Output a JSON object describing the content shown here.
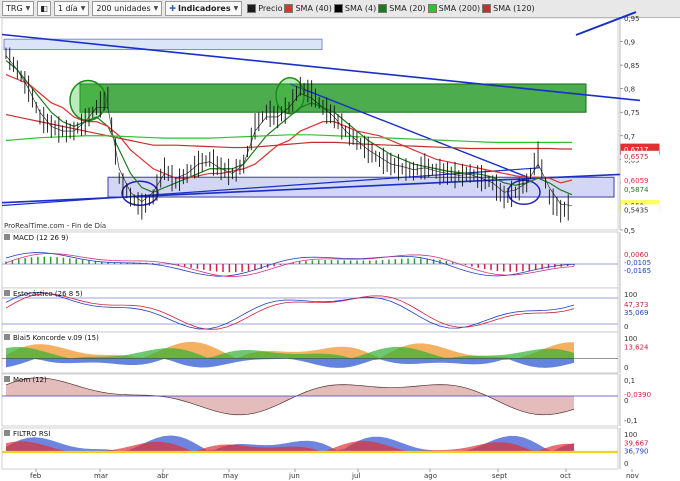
{
  "toolbar": {
    "symbol": "TRG",
    "timeframe": "1 día",
    "units": "200 unidades",
    "indicators_label": "Indicadores",
    "legend": [
      {
        "label": "Precio",
        "color": "#1a1a1a"
      },
      {
        "label": "SMA (40)",
        "color": "#e03030"
      },
      {
        "label": "SMA (4)",
        "color": "#000000"
      },
      {
        "label": "SMA (20)",
        "color": "#1f7a1f"
      },
      {
        "label": "SMA (200)",
        "color": "#30c030"
      },
      {
        "label": "SMA (120)",
        "color": "#c03030"
      }
    ]
  },
  "watermark": "ProRealTime.com - Fin de Día",
  "months": [
    "feb",
    "mar",
    "abr",
    "may",
    "jun",
    "jul",
    "ago",
    "sept",
    "oct",
    "nov"
  ],
  "chart_data": [
    {
      "type": "line",
      "name": "price",
      "ylim": [
        0.5,
        0.95
      ],
      "y_ticks": [
        "0,95",
        "0,9",
        "0,85",
        "0,8",
        "0,75",
        "0,7",
        "0,65",
        "0,6",
        "0,55",
        "0,5"
      ],
      "x_months": [
        "feb",
        "mar",
        "abr",
        "may",
        "jun",
        "jul",
        "ago",
        "sept",
        "oct",
        "nov"
      ],
      "price_series": [
        0.875,
        0.84,
        0.8,
        0.74,
        0.72,
        0.71,
        0.71,
        0.73,
        0.76,
        0.78,
        0.61,
        0.57,
        0.55,
        0.57,
        0.63,
        0.6,
        0.62,
        0.64,
        0.65,
        0.63,
        0.62,
        0.64,
        0.72,
        0.75,
        0.74,
        0.76,
        0.805,
        0.79,
        0.76,
        0.74,
        0.71,
        0.69,
        0.67,
        0.65,
        0.64,
        0.63,
        0.625,
        0.635,
        0.625,
        0.62,
        0.615,
        0.62,
        0.61,
        0.6,
        0.57,
        0.58,
        0.6,
        0.66,
        0.57,
        0.54,
        0.552
      ],
      "sma_series": [
        {
          "name": "SMA (4)",
          "color": "#1a1a1a",
          "values": [
            0.87,
            0.84,
            0.8,
            0.75,
            0.72,
            0.71,
            0.71,
            0.73,
            0.76,
            0.76,
            0.63,
            0.58,
            0.56,
            0.58,
            0.62,
            0.61,
            0.62,
            0.64,
            0.645,
            0.63,
            0.62,
            0.64,
            0.71,
            0.74,
            0.74,
            0.76,
            0.79,
            0.78,
            0.76,
            0.74,
            0.71,
            0.69,
            0.67,
            0.655,
            0.64,
            0.635,
            0.628,
            0.632,
            0.625,
            0.62,
            0.616,
            0.618,
            0.61,
            0.6,
            0.58,
            0.585,
            0.6,
            0.64,
            0.59,
            0.555,
            0.552
          ]
        },
        {
          "name": "SMA (20)",
          "color": "#1f7a1f",
          "values": [
            0.86,
            0.84,
            0.81,
            0.78,
            0.75,
            0.73,
            0.72,
            0.73,
            0.74,
            0.72,
            0.67,
            0.62,
            0.59,
            0.58,
            0.59,
            0.6,
            0.61,
            0.62,
            0.63,
            0.63,
            0.63,
            0.64,
            0.67,
            0.7,
            0.72,
            0.74,
            0.76,
            0.77,
            0.76,
            0.75,
            0.73,
            0.71,
            0.69,
            0.675,
            0.66,
            0.65,
            0.64,
            0.635,
            0.63,
            0.625,
            0.622,
            0.62,
            0.618,
            0.612,
            0.6,
            0.595,
            0.6,
            0.61,
            0.6,
            0.585,
            0.575
          ]
        },
        {
          "name": "SMA (40)",
          "color": "#e03030",
          "values": [
            0.83,
            0.82,
            0.81,
            0.79,
            0.77,
            0.76,
            0.74,
            0.73,
            0.73,
            0.72,
            0.7,
            0.67,
            0.65,
            0.63,
            0.62,
            0.61,
            0.61,
            0.615,
            0.62,
            0.62,
            0.625,
            0.63,
            0.64,
            0.66,
            0.68,
            0.69,
            0.71,
            0.72,
            0.73,
            0.73,
            0.72,
            0.71,
            0.705,
            0.7,
            0.69,
            0.68,
            0.67,
            0.66,
            0.65,
            0.645,
            0.64,
            0.635,
            0.63,
            0.625,
            0.62,
            0.615,
            0.612,
            0.612,
            0.61,
            0.6,
            0.606
          ]
        },
        {
          "name": "SMA (120)",
          "color": "#c03030",
          "values": [
            0.745,
            0.74,
            0.735,
            0.73,
            0.725,
            0.72,
            0.715,
            0.71,
            0.705,
            0.7,
            0.695,
            0.69,
            0.685,
            0.68,
            0.68,
            0.68,
            0.679,
            0.678,
            0.677,
            0.676,
            0.675,
            0.675,
            0.676,
            0.678,
            0.68,
            0.682,
            0.684,
            0.686,
            0.686,
            0.686,
            0.685,
            0.683,
            0.682,
            0.681,
            0.68,
            0.679,
            0.678,
            0.677,
            0.676,
            0.675,
            0.674,
            0.673,
            0.673,
            0.673,
            0.673,
            0.673,
            0.673,
            0.673,
            0.673,
            0.672,
            0.672
          ]
        },
        {
          "name": "SMA (200)",
          "color": "#30c030",
          "values": [
            0.69,
            0.692,
            0.694,
            0.696,
            0.697,
            0.698,
            0.699,
            0.7,
            0.7,
            0.7,
            0.699,
            0.698,
            0.697,
            0.696,
            0.695,
            0.695,
            0.695,
            0.695,
            0.695,
            0.696,
            0.697,
            0.698,
            0.699,
            0.7,
            0.701,
            0.702,
            0.702,
            0.702,
            0.701,
            0.7,
            0.699,
            0.698,
            0.697,
            0.696,
            0.695,
            0.694,
            0.693,
            0.692,
            0.691,
            0.69,
            0.689,
            0.688,
            0.687,
            0.686,
            0.686,
            0.686,
            0.686,
            0.686,
            0.686,
            0.686,
            0.686
          ]
        }
      ],
      "value_tags": [
        {
          "label": "0,6717",
          "value": 0.6717,
          "bg": "#e03030",
          "fg": "#ffffff"
        },
        {
          "label": "0,6575",
          "value": 0.6575,
          "bg": "#ffffff",
          "fg": "#c03030"
        },
        {
          "label": "0,6059",
          "value": 0.6059,
          "bg": "#ffffff",
          "fg": "#e03030"
        },
        {
          "label": "0,5874",
          "value": 0.5874,
          "bg": "#ffffff",
          "fg": "#1f7a1f"
        },
        {
          "label": "0,552",
          "value": 0.552,
          "bg": "#ffff66",
          "fg": "#111111"
        },
        {
          "label": "0,5435",
          "value": 0.5435,
          "bg": "#ffffff",
          "fg": "#333333"
        }
      ]
    },
    {
      "type": "bar",
      "name": "MACD (12 26 9)",
      "tags": [
        "0,0060",
        "-0,0105",
        "-0,0165"
      ],
      "ylim": [
        -0.05,
        0.05
      ]
    },
    {
      "type": "line",
      "name": "Estocástico (26 8 5)",
      "tags": [
        "47,373",
        "35,069"
      ],
      "y_ticks": [
        "100",
        "0"
      ],
      "ylim": [
        0,
        100
      ]
    },
    {
      "type": "area",
      "name": "Blai5 Koncorde v.09 (15)",
      "tags": [
        "13,624"
      ],
      "y_ticks": [
        "100",
        "0"
      ]
    },
    {
      "type": "area",
      "name": "Mom (12)",
      "tags": [
        "-0,0390"
      ],
      "y_ticks": [
        "0,1",
        "0",
        "-0,1"
      ]
    },
    {
      "type": "area",
      "name": "FILTRO RSI",
      "tags": [
        "39,667",
        "36,790"
      ],
      "y_ticks": [
        "100",
        "0"
      ]
    }
  ]
}
